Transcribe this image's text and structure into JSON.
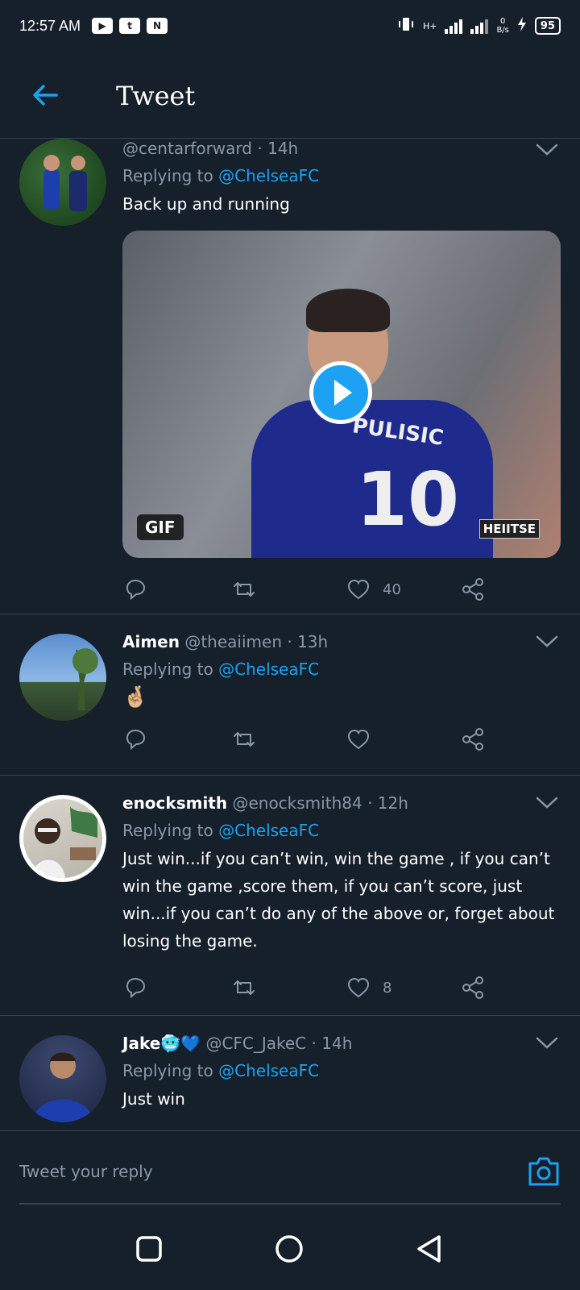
{
  "status": {
    "time": "12:57 AM",
    "apps": [
      "▶",
      "t",
      "N"
    ],
    "net_speed_value": "0",
    "net_speed_unit": "B/s",
    "network": "H+",
    "battery": "95"
  },
  "header": {
    "title": "Tweet"
  },
  "tweets": [
    {
      "handle": "@centarforward",
      "time": "14h",
      "replying_label": "Replying to",
      "mention": "@ChelseaFC",
      "text": "Back up and running",
      "media": {
        "badge": "GIF",
        "watermark": "HEIITSE",
        "jersey_name": "PULISIC",
        "jersey_number": "10"
      },
      "likes": "40"
    },
    {
      "name": "Aimen",
      "handle": "@theaiimen",
      "time": "13h",
      "replying_label": "Replying to",
      "mention": "@ChelseaFC",
      "text": "🤞🏼"
    },
    {
      "name": "enocksmith",
      "handle": "@enocksmith84",
      "time": "12h",
      "replying_label": "Replying to",
      "mention": "@ChelseaFC",
      "text": "Just win...if you can’t win, win the game , if you can’t win the game ,score them, if you can’t score, just win...if you can’t do any of the above or,  forget about losing the game.",
      "likes": "8"
    },
    {
      "name": "Jake🥶💙",
      "handle": "@CFC_JakeC",
      "time": "14h",
      "replying_label": "Replying to",
      "mention": "@ChelseaFC",
      "text": "Just win"
    }
  ],
  "reply": {
    "placeholder": "Tweet your reply"
  },
  "colors": {
    "accent": "#1da1f2",
    "background": "#15202b",
    "muted": "#8899a6",
    "divider": "#38444d"
  },
  "icons": [
    "back-arrow-icon",
    "chevron-down-icon",
    "reply-icon",
    "retweet-icon",
    "like-icon",
    "share-icon",
    "camera-icon",
    "play-icon",
    "nav-recents-icon",
    "nav-home-icon",
    "nav-back-icon"
  ]
}
